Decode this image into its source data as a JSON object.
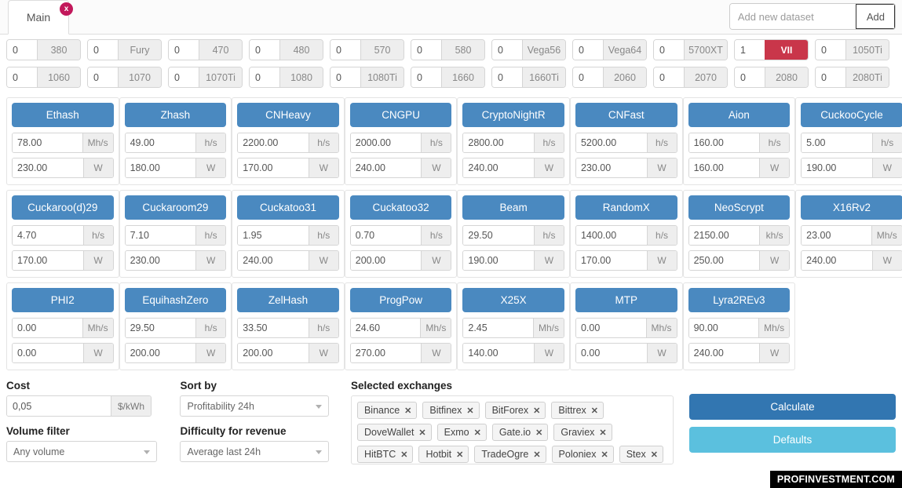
{
  "colors": {
    "algo_header_blue": "#4a89c0",
    "calculate_blue": "#3276b1",
    "defaults_blue": "#5bc0de",
    "active_gpu_red": "#c9364a",
    "tab_close_pink": "#c2185b"
  },
  "topbar": {
    "tab_label": "Main",
    "tab_close_glyph": "x",
    "add_dataset_placeholder": "Add new dataset",
    "add_dataset_value": "",
    "add_button_label": "Add"
  },
  "gpus": {
    "row1": [
      {
        "qty": "0",
        "name": "380",
        "active": false
      },
      {
        "qty": "0",
        "name": "Fury",
        "active": false
      },
      {
        "qty": "0",
        "name": "470",
        "active": false
      },
      {
        "qty": "0",
        "name": "480",
        "active": false
      },
      {
        "qty": "0",
        "name": "570",
        "active": false
      },
      {
        "qty": "0",
        "name": "580",
        "active": false
      },
      {
        "qty": "0",
        "name": "Vega56",
        "active": false
      },
      {
        "qty": "0",
        "name": "Vega64",
        "active": false
      },
      {
        "qty": "0",
        "name": "5700XT",
        "active": false
      },
      {
        "qty": "1",
        "name": "VII",
        "active": true
      },
      {
        "qty": "0",
        "name": "1050Ti",
        "active": false
      }
    ],
    "row2": [
      {
        "qty": "0",
        "name": "1060",
        "active": false
      },
      {
        "qty": "0",
        "name": "1070",
        "active": false
      },
      {
        "qty": "0",
        "name": "1070Ti",
        "active": false
      },
      {
        "qty": "0",
        "name": "1080",
        "active": false
      },
      {
        "qty": "0",
        "name": "1080Ti",
        "active": false
      },
      {
        "qty": "0",
        "name": "1660",
        "active": false
      },
      {
        "qty": "0",
        "name": "1660Ti",
        "active": false
      },
      {
        "qty": "0",
        "name": "2060",
        "active": false
      },
      {
        "qty": "0",
        "name": "2070",
        "active": false
      },
      {
        "qty": "0",
        "name": "2080",
        "active": false
      },
      {
        "qty": "0",
        "name": "2080Ti",
        "active": false
      }
    ]
  },
  "algorithms": [
    [
      {
        "name": "Ethash",
        "hashrate": "78.00",
        "hash_unit": "Mh/s",
        "power": "230.00",
        "power_unit": "W"
      },
      {
        "name": "Zhash",
        "hashrate": "49.00",
        "hash_unit": "h/s",
        "power": "180.00",
        "power_unit": "W"
      },
      {
        "name": "CNHeavy",
        "hashrate": "2200.00",
        "hash_unit": "h/s",
        "power": "170.00",
        "power_unit": "W"
      },
      {
        "name": "CNGPU",
        "hashrate": "2000.00",
        "hash_unit": "h/s",
        "power": "240.00",
        "power_unit": "W"
      },
      {
        "name": "CryptoNightR",
        "hashrate": "2800.00",
        "hash_unit": "h/s",
        "power": "240.00",
        "power_unit": "W"
      },
      {
        "name": "CNFast",
        "hashrate": "5200.00",
        "hash_unit": "h/s",
        "power": "230.00",
        "power_unit": "W"
      },
      {
        "name": "Aion",
        "hashrate": "160.00",
        "hash_unit": "h/s",
        "power": "160.00",
        "power_unit": "W"
      },
      {
        "name": "CuckooCycle",
        "hashrate": "5.00",
        "hash_unit": "h/s",
        "power": "190.00",
        "power_unit": "W"
      }
    ],
    [
      {
        "name": "Cuckaroo(d)29",
        "hashrate": "4.70",
        "hash_unit": "h/s",
        "power": "170.00",
        "power_unit": "W"
      },
      {
        "name": "Cuckaroom29",
        "hashrate": "7.10",
        "hash_unit": "h/s",
        "power": "230.00",
        "power_unit": "W"
      },
      {
        "name": "Cuckatoo31",
        "hashrate": "1.95",
        "hash_unit": "h/s",
        "power": "240.00",
        "power_unit": "W"
      },
      {
        "name": "Cuckatoo32",
        "hashrate": "0.70",
        "hash_unit": "h/s",
        "power": "200.00",
        "power_unit": "W"
      },
      {
        "name": "Beam",
        "hashrate": "29.50",
        "hash_unit": "h/s",
        "power": "190.00",
        "power_unit": "W"
      },
      {
        "name": "RandomX",
        "hashrate": "1400.00",
        "hash_unit": "h/s",
        "power": "170.00",
        "power_unit": "W"
      },
      {
        "name": "NeoScrypt",
        "hashrate": "2150.00",
        "hash_unit": "kh/s",
        "power": "250.00",
        "power_unit": "W"
      },
      {
        "name": "X16Rv2",
        "hashrate": "23.00",
        "hash_unit": "Mh/s",
        "power": "240.00",
        "power_unit": "W"
      }
    ],
    [
      {
        "name": "PHI2",
        "hashrate": "0.00",
        "hash_unit": "Mh/s",
        "power": "0.00",
        "power_unit": "W"
      },
      {
        "name": "EquihashZero",
        "hashrate": "29.50",
        "hash_unit": "h/s",
        "power": "200.00",
        "power_unit": "W"
      },
      {
        "name": "ZelHash",
        "hashrate": "33.50",
        "hash_unit": "h/s",
        "power": "200.00",
        "power_unit": "W"
      },
      {
        "name": "ProgPow",
        "hashrate": "24.60",
        "hash_unit": "Mh/s",
        "power": "270.00",
        "power_unit": "W"
      },
      {
        "name": "X25X",
        "hashrate": "2.45",
        "hash_unit": "Mh/s",
        "power": "140.00",
        "power_unit": "W"
      },
      {
        "name": "MTP",
        "hashrate": "0.00",
        "hash_unit": "Mh/s",
        "power": "0.00",
        "power_unit": "W"
      },
      {
        "name": "Lyra2REv3",
        "hashrate": "90.00",
        "hash_unit": "Mh/s",
        "power": "240.00",
        "power_unit": "W"
      }
    ]
  ],
  "controls": {
    "cost_label": "Cost",
    "cost_value": "0,05",
    "cost_unit": "$/kWh",
    "volume_filter_label": "Volume filter",
    "volume_filter_value": "Any volume",
    "sort_by_label": "Sort by",
    "sort_by_value": "Profitability 24h",
    "difficulty_label": "Difficulty for revenue",
    "difficulty_value": "Average last 24h",
    "exchanges_label": "Selected exchanges",
    "exchanges": [
      "Binance",
      "Bitfinex",
      "BitForex",
      "Bittrex",
      "DoveWallet",
      "Exmo",
      "Gate.io",
      "Graviex",
      "HitBTC",
      "Hotbit",
      "TradeOgre",
      "Poloniex",
      "Stex"
    ],
    "tag_close_glyph": "✕",
    "calculate_label": "Calculate",
    "defaults_label": "Defaults"
  },
  "watermark": "PROFINVESTMENT.COM"
}
